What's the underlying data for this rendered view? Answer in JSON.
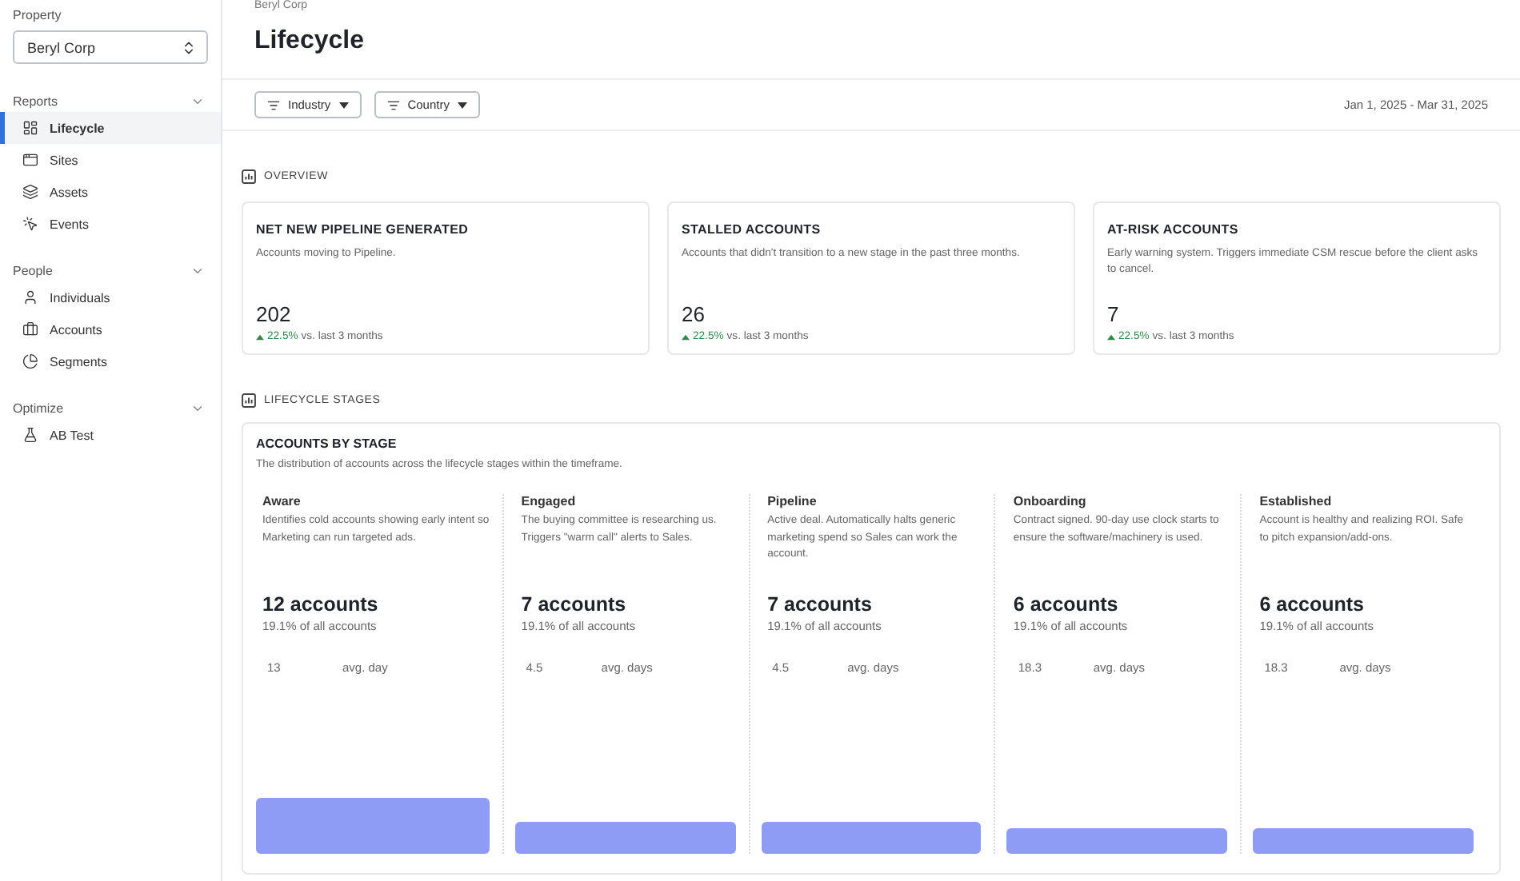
{
  "sidebar": {
    "property_label": "Property",
    "property_value": "Beryl Corp",
    "groups": [
      {
        "title": "Reports",
        "items": [
          {
            "label": "Lifecycle",
            "selected": true
          },
          {
            "label": "Sites",
            "selected": false
          },
          {
            "label": "Assets",
            "selected": false
          },
          {
            "label": "Events",
            "selected": false
          }
        ]
      },
      {
        "title": "People",
        "items": [
          {
            "label": "Individuals",
            "selected": false
          },
          {
            "label": "Accounts",
            "selected": false
          },
          {
            "label": "Segments",
            "selected": false
          }
        ]
      },
      {
        "title": "Optimize",
        "items": [
          {
            "label": "AB Test",
            "selected": false
          }
        ]
      }
    ]
  },
  "header": {
    "breadcrumb": "Beryl Corp",
    "title": "Lifecycle"
  },
  "filters": [
    "Industry",
    "Country"
  ],
  "date_range": "Jan 1, 2025 - Mar 31, 2025",
  "overview": {
    "label": "OVERVIEW",
    "cards": [
      {
        "title": "NET NEW PIPELINE GENERATED",
        "description": "Accounts moving to Pipeline.",
        "value": "202",
        "delta": "22.5%",
        "delta_note": "vs. last 3 months"
      },
      {
        "title": "STALLED ACCOUNTS",
        "description": "Accounts that didn't transition to a new stage in the past three months.",
        "value": "26",
        "delta": "22.5%",
        "delta_note": "vs. last 3 months"
      },
      {
        "title": "AT-RISK ACCOUNTS",
        "description": "Early warning system. Triggers immediate CSM rescue before the client asks to cancel.",
        "value": "7",
        "delta": "22.5%",
        "delta_note": "vs. last 3 months"
      }
    ]
  },
  "lifecycle": {
    "label": "LIFECYCLE STAGES",
    "title": "ACCOUNTS BY STAGE",
    "description": "The distribution of accounts across the lifecycle stages within the timeframe.",
    "stages": [
      {
        "name": "Aware",
        "description": "Identifies cold accounts showing early intent so Marketing can run targeted ads.",
        "count": "12 accounts",
        "share": "19.1% of all accounts",
        "avg_value": "13",
        "avg_unit": "avg. day",
        "kind": "tall"
      },
      {
        "name": "Engaged",
        "description": "The buying committee is researching us. Triggers \"warm call\" alerts to Sales.",
        "count": "7 accounts",
        "share": "19.1% of all accounts",
        "avg_value": "4.5",
        "avg_unit": "avg. days",
        "kind": "medium"
      },
      {
        "name": "Pipeline",
        "description": "Active deal. Automatically halts generic marketing spend so Sales can work the account.",
        "count": "7 accounts",
        "share": "19.1% of all accounts",
        "avg_value": "4.5",
        "avg_unit": "avg. days",
        "kind": "medium"
      },
      {
        "name": "Onboarding",
        "description": "Contract signed. 90-day use clock starts to ensure the software/machinery is used.",
        "count": "6 accounts",
        "share": "19.1% of all accounts",
        "avg_value": "18.3",
        "avg_unit": "avg. days",
        "kind": "short"
      },
      {
        "name": "Established",
        "description": "Account is healthy and realizing ROI. Safe to pitch expansion/add-ons.",
        "count": "6 accounts",
        "share": "19.1% of all accounts",
        "avg_value": "18.3",
        "avg_unit": "avg. days",
        "kind": "short"
      }
    ]
  }
}
